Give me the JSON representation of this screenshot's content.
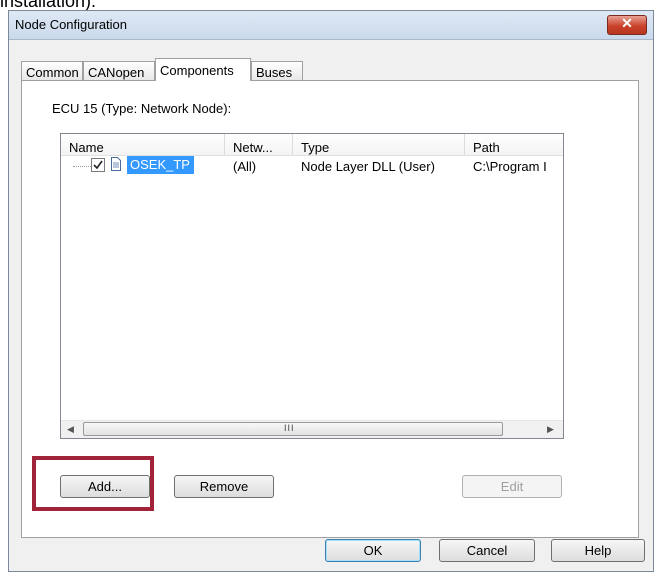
{
  "top_text": "installation).",
  "window": {
    "title": "Node Configuration",
    "close_glyph": "✕"
  },
  "tabs": [
    {
      "label": "Common",
      "active": false
    },
    {
      "label": "CANopen",
      "active": false
    },
    {
      "label": "Components",
      "active": true
    },
    {
      "label": "Buses",
      "active": false
    }
  ],
  "panel": {
    "ecu_label": "ECU 15 (Type: Network Node):",
    "columns": [
      "Name",
      "Netw...",
      "Type",
      "Path"
    ],
    "rows": [
      {
        "checked": true,
        "icon": "document-icon",
        "name": "OSEK_TP",
        "network": "(All)",
        "type": "Node Layer DLL (User)",
        "path": "C:\\Program I"
      }
    ],
    "scroll_grip": "III",
    "buttons": {
      "add": "Add...",
      "remove": "Remove",
      "edit": "Edit"
    }
  },
  "footer": {
    "ok": "OK",
    "cancel": "Cancel",
    "help": "Help"
  },
  "colors": {
    "selection": "#3399ff",
    "highlight_box": "#a0233a",
    "close_button": "#c9422b"
  }
}
